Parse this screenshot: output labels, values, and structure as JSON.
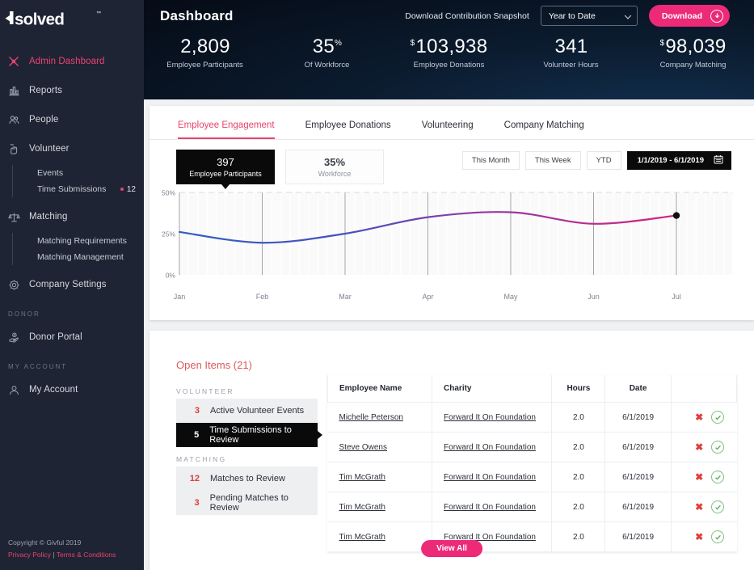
{
  "sidebar": {
    "logo_text": "isolved",
    "items": [
      {
        "label": "Admin Dashboard",
        "icon": "ribbon-icon",
        "active": true
      },
      {
        "label": "Reports",
        "icon": "bar-chart-icon",
        "active": false
      },
      {
        "label": "People",
        "icon": "people-icon",
        "active": false
      },
      {
        "label": "Volunteer",
        "icon": "hand-heart-icon",
        "active": false
      }
    ],
    "volunteer_sub": [
      {
        "label": "Events",
        "badge": ""
      },
      {
        "label": "Time Submissions",
        "badge": "12"
      }
    ],
    "matching": {
      "label": "Matching",
      "icon": "scales-icon"
    },
    "matching_sub": [
      {
        "label": "Matching Requirements"
      },
      {
        "label": "Matching Management"
      }
    ],
    "company_settings": {
      "label": "Company Settings",
      "icon": "gear-icon"
    },
    "donor_section": "DONOR",
    "donor_portal": {
      "label": "Donor Portal",
      "icon": "donate-hand-icon"
    },
    "account_section": "MY ACCOUNT",
    "my_account": {
      "label": "My Account",
      "icon": "user-icon"
    },
    "footer": {
      "copyright": "Copyright © Givful 2019",
      "privacy": "Privacy Policy",
      "separator": "|",
      "terms": "Terms & Conditions"
    }
  },
  "header": {
    "title": "Dashboard",
    "snapshot_label": "Download Contribution Snapshot",
    "range_selected": "Year to Date",
    "download_label": "Download",
    "stats": [
      {
        "prefix": "",
        "value": "2,809",
        "suffix": "",
        "caption": "Employee Participants"
      },
      {
        "prefix": "",
        "value": "35",
        "suffix": "%",
        "caption": "Of Workforce"
      },
      {
        "prefix": "$",
        "value": "103,938",
        "suffix": "",
        "caption": "Employee Donations"
      },
      {
        "prefix": "",
        "value": "341",
        "suffix": "",
        "caption": "Volunteer Hours"
      },
      {
        "prefix": "$",
        "value": "98,039",
        "suffix": "",
        "caption": "Company Matching"
      }
    ]
  },
  "tabs": [
    {
      "label": "Employee Engagement",
      "active": true
    },
    {
      "label": "Employee Donations",
      "active": false
    },
    {
      "label": "Volunteering",
      "active": false
    },
    {
      "label": "Company Matching",
      "active": false
    }
  ],
  "chart_kpis": [
    {
      "value": "397",
      "caption": "Employee Participants",
      "selected": true
    },
    {
      "value": "35%",
      "caption": "Workforce",
      "selected": false
    }
  ],
  "range_buttons": [
    {
      "label": "This Month",
      "selected": false
    },
    {
      "label": "This Week",
      "selected": false
    },
    {
      "label": "YTD",
      "selected": false
    },
    {
      "label": "1/1/2019 - 6/1/2019",
      "selected": true,
      "icon": "calendar-icon"
    }
  ],
  "chart_data": {
    "type": "line",
    "title": "",
    "xlabel": "",
    "ylabel": "",
    "ylim": [
      0,
      50
    ],
    "ytick_labels": [
      "0%",
      "25%",
      "50%"
    ],
    "yticks": [
      0,
      25,
      50
    ],
    "grid": true,
    "legend": "none",
    "x": [
      "Jan",
      "Feb",
      "Mar",
      "Apr",
      "May",
      "Jun",
      "Jul"
    ],
    "series": [
      {
        "name": "Employee Participants",
        "color_start": "#2f5fc4",
        "color_end": "#d6247f",
        "values": [
          26,
          19.5,
          25,
          35,
          38,
          31,
          36
        ]
      }
    ],
    "last_point_marker": true,
    "last_point": {
      "x": "Jul",
      "y": 36
    }
  },
  "open_items": {
    "title": "Open Items (21)",
    "groups": [
      {
        "section": "VOLUNTEER",
        "rows": [
          {
            "count": "3",
            "label": "Active Volunteer Events",
            "selected": false
          },
          {
            "count": "5",
            "label": "Time Submissions to Review",
            "selected": true
          }
        ]
      },
      {
        "section": "MATCHING",
        "rows": [
          {
            "count": "12",
            "label": "Matches to Review",
            "selected": false
          },
          {
            "count": "3",
            "label": "Pending Matches to Review",
            "selected": false
          }
        ]
      }
    ]
  },
  "table": {
    "columns": [
      "Employee Name",
      "Charity",
      "Hours",
      "Date",
      ""
    ],
    "rows": [
      {
        "name": "Michelle Peterson",
        "charity": "Forward It On Foundation",
        "hours": "2.0",
        "date": "6/1/2019"
      },
      {
        "name": "Steve Owens",
        "charity": "Forward It On Foundation",
        "hours": "2.0",
        "date": "6/1/2019"
      },
      {
        "name": "Tim McGrath",
        "charity": "Forward It On Foundation",
        "hours": "2.0",
        "date": "6/1/2019"
      },
      {
        "name": "Tim McGrath",
        "charity": "Forward It On Foundation",
        "hours": "2.0",
        "date": "6/1/2019"
      },
      {
        "name": "Tim McGrath",
        "charity": "Forward It On Foundation",
        "hours": "2.0",
        "date": "6/1/2019"
      }
    ],
    "view_all_label": "View All",
    "reject_icon": "x-icon",
    "approve_icon": "check-circle-icon"
  },
  "colors": {
    "accent_pink": "#ec2a78",
    "sidebar_bg": "#1e2433",
    "header_bg": "#050a14",
    "line_start": "#2f5fc4",
    "line_end": "#d6247f"
  }
}
